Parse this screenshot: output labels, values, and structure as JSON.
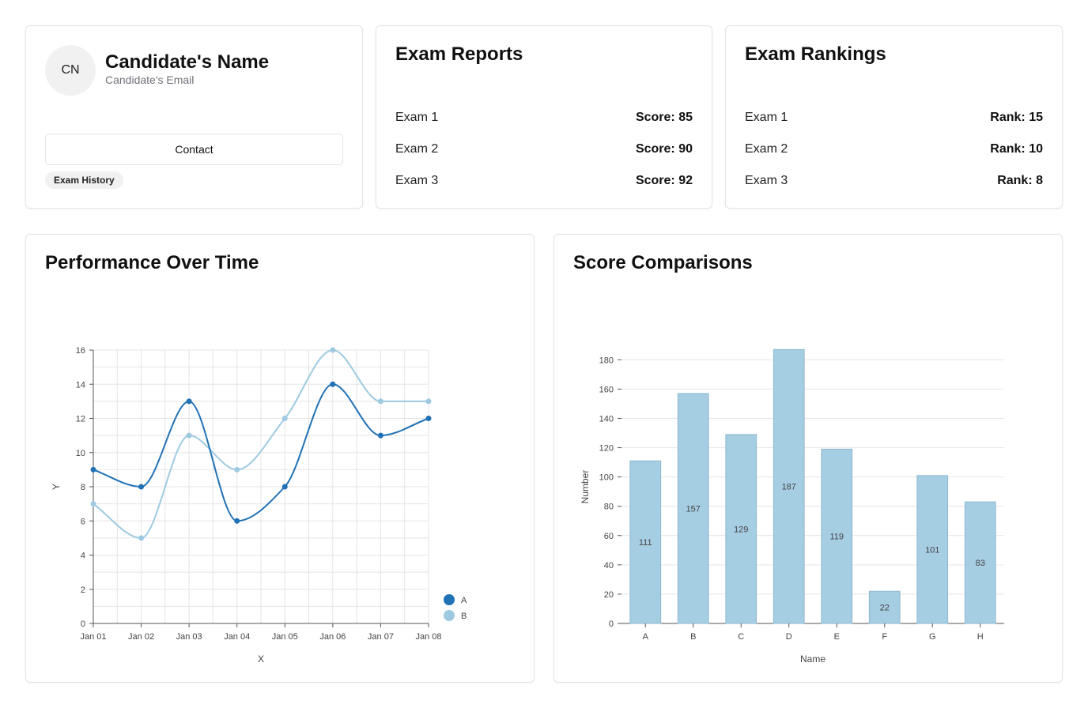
{
  "profile": {
    "avatar_initials": "CN",
    "name": "Candidate's Name",
    "email": "Candidate's Email",
    "contact_label": "Contact",
    "history_label": "Exam History"
  },
  "reports": {
    "title": "Exam Reports",
    "items": [
      {
        "label": "Exam 1",
        "value": "Score: 85"
      },
      {
        "label": "Exam 2",
        "value": "Score: 90"
      },
      {
        "label": "Exam 3",
        "value": "Score: 92"
      }
    ]
  },
  "rankings": {
    "title": "Exam Rankings",
    "items": [
      {
        "label": "Exam 1",
        "value": "Rank: 15"
      },
      {
        "label": "Exam 2",
        "value": "Rank: 10"
      },
      {
        "label": "Exam 3",
        "value": "Rank: 8"
      }
    ]
  },
  "performance": {
    "title": "Performance Over Time"
  },
  "scores": {
    "title": "Score Comparisons"
  },
  "colors": {
    "series_a": "#2171b5",
    "series_b": "#9ecae1",
    "bar_fill": "#a6cee3",
    "grid": "#e5e5e5"
  },
  "chart_data": [
    {
      "type": "line",
      "x": [
        "Jan 01",
        "Jan 02",
        "Jan 03",
        "Jan 04",
        "Jan 05",
        "Jan 06",
        "Jan 07",
        "Jan 08"
      ],
      "series": [
        {
          "name": "A",
          "values": [
            9,
            8,
            13,
            6,
            8,
            14,
            11,
            12
          ]
        },
        {
          "name": "B",
          "values": [
            7,
            5,
            11,
            9,
            12,
            16,
            13,
            13
          ]
        }
      ],
      "xlabel": "X",
      "ylabel": "Y",
      "ylim": [
        0,
        16
      ],
      "yticks": [
        0,
        2,
        4,
        6,
        8,
        10,
        12,
        14,
        16
      ],
      "grid": true,
      "legend": "bottom-right"
    },
    {
      "type": "bar",
      "categories": [
        "A",
        "B",
        "C",
        "D",
        "E",
        "F",
        "G",
        "H"
      ],
      "values": [
        111,
        157,
        129,
        187,
        119,
        22,
        101,
        83
      ],
      "xlabel": "Name",
      "ylabel": "Number",
      "ylim": [
        0,
        180
      ],
      "yticks": [
        0,
        20,
        40,
        60,
        80,
        100,
        120,
        140,
        160,
        180
      ],
      "grid": true,
      "data_labels": true
    }
  ]
}
